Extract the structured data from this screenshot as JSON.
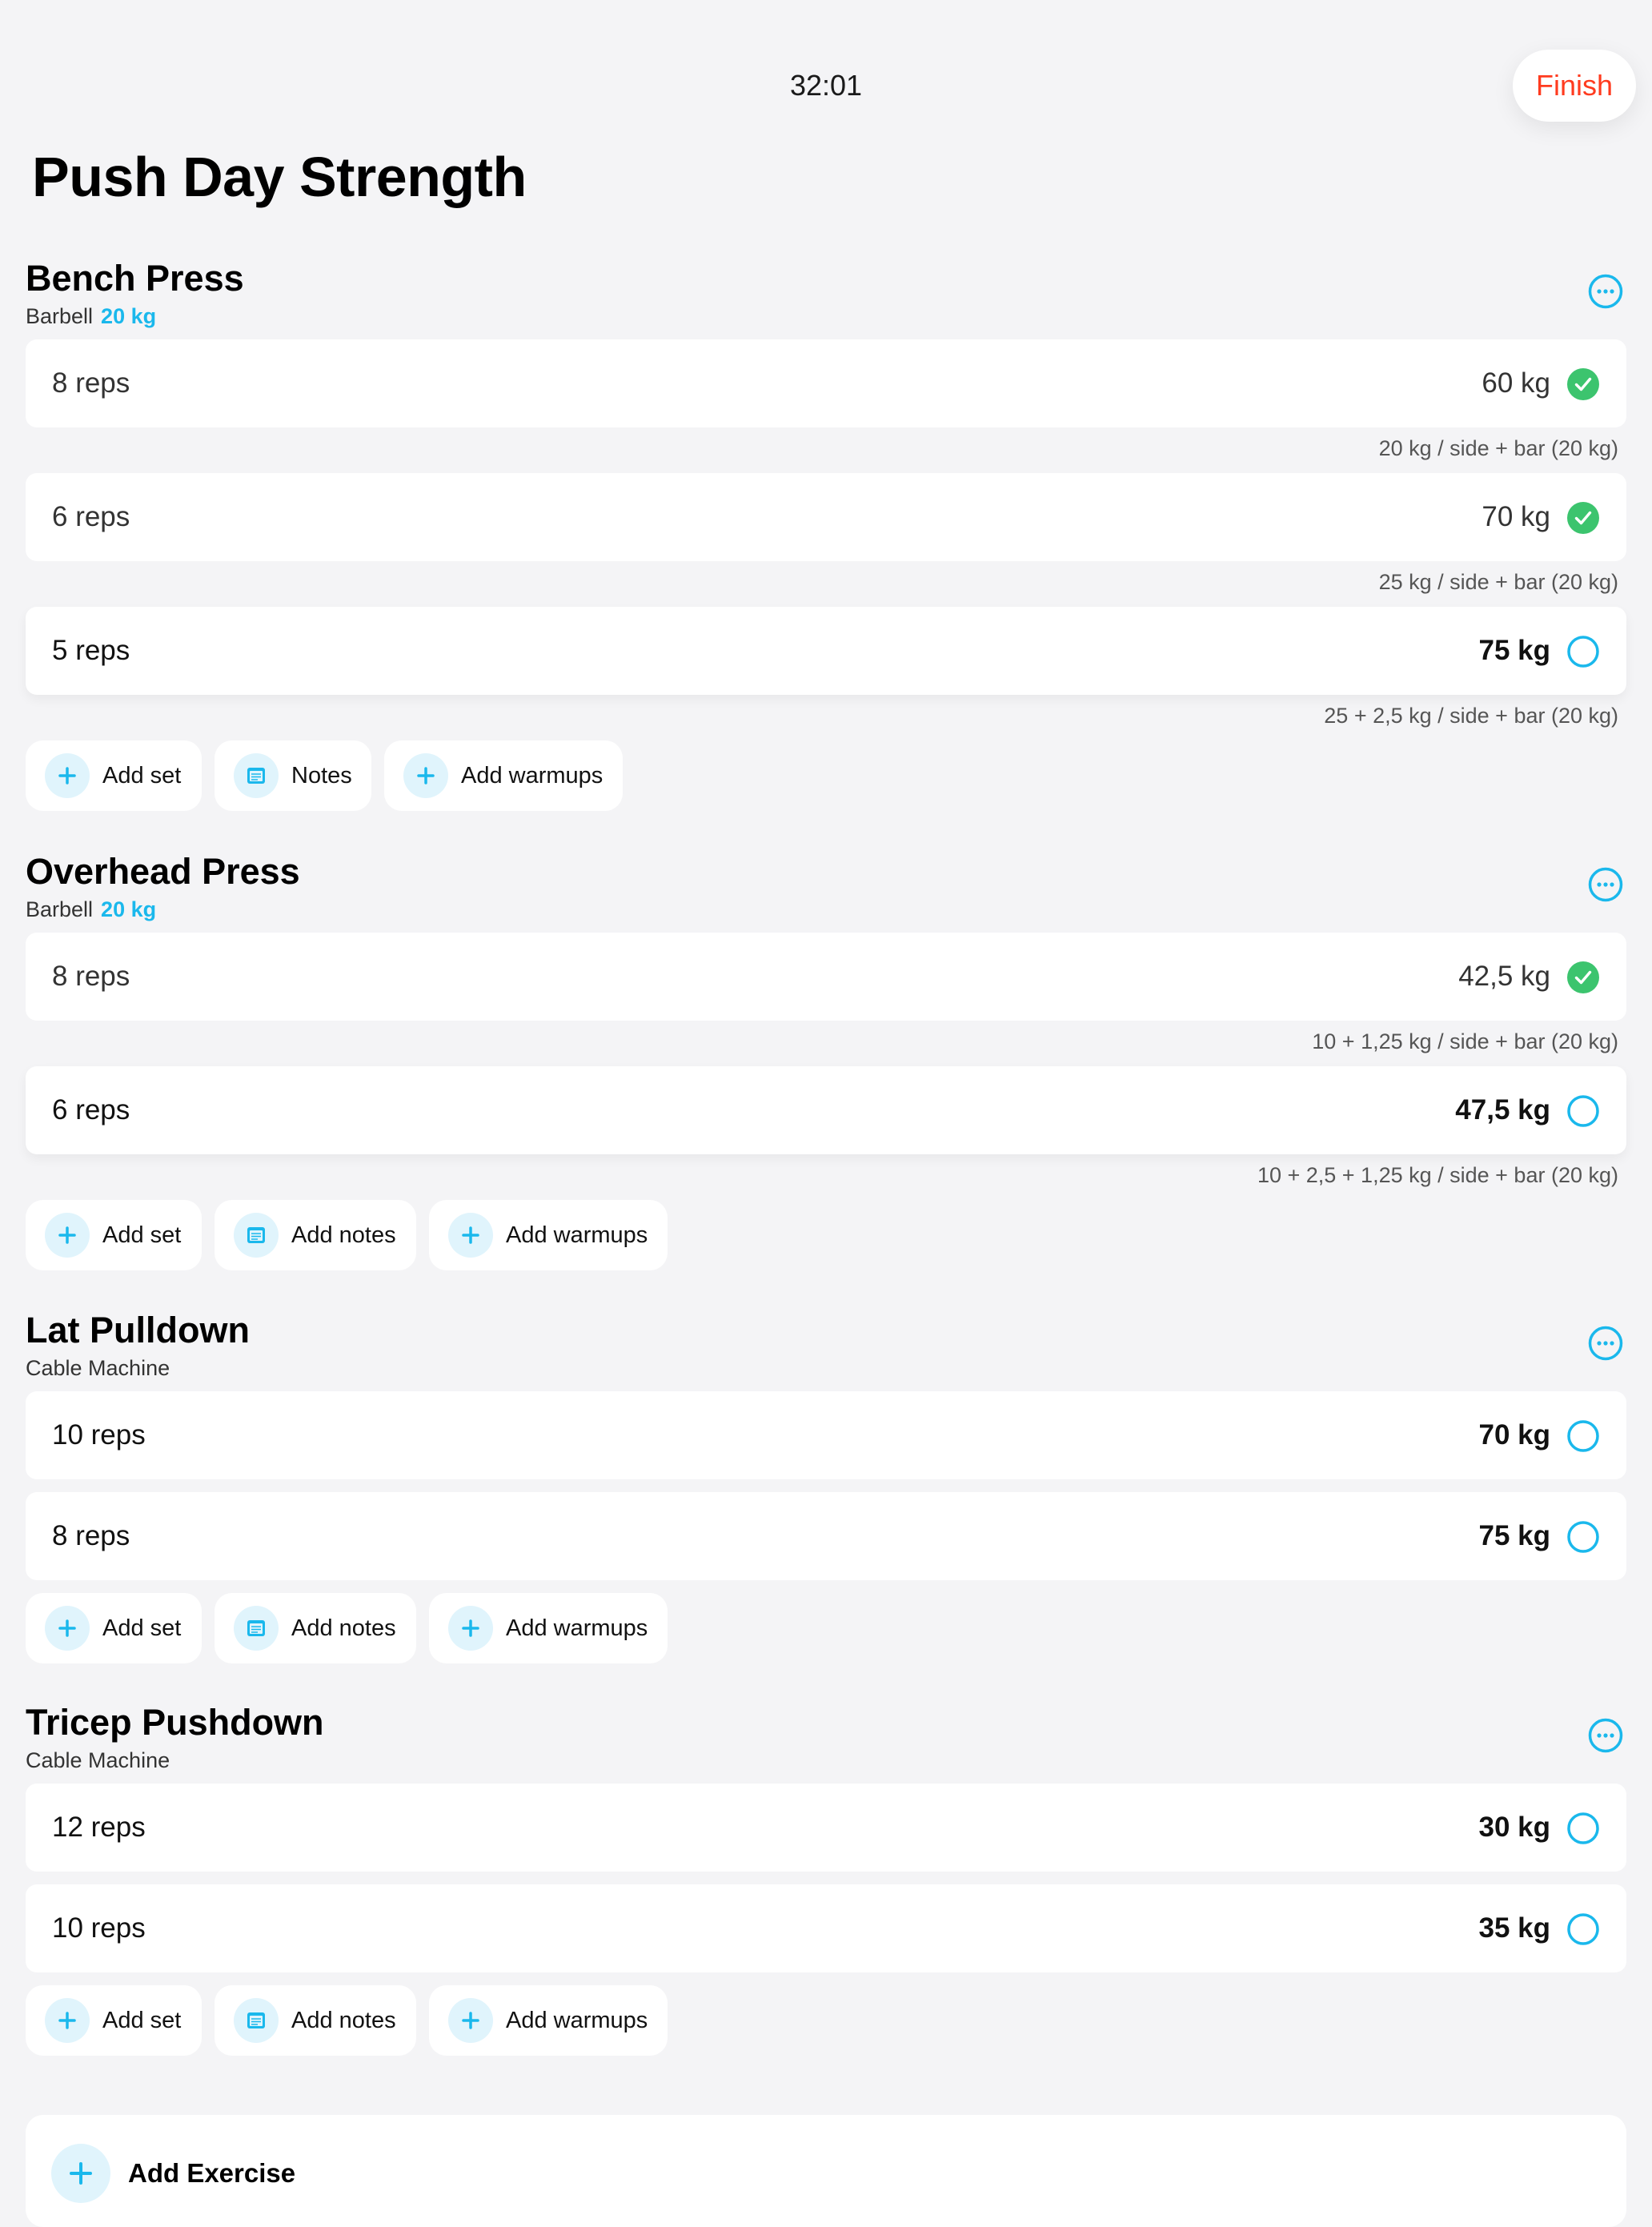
{
  "header": {
    "timer": "32:01",
    "finish_label": "Finish"
  },
  "page_title": "Push Day Strength",
  "colors": {
    "accent": "#1ab8ec",
    "done": "#3cc46e",
    "finish": "#ff3b1f"
  },
  "icons": {
    "more": "more-horizontal-icon",
    "done": "check-circle-icon",
    "pending": "empty-circle-icon",
    "add": "plus-icon",
    "notes": "notes-icon"
  },
  "exercises": [
    {
      "name": "Bench Press",
      "equipment": "Barbell",
      "bar_weight": "20 kg",
      "sets": [
        {
          "reps": "8 reps",
          "weight": "60 kg",
          "done": true,
          "plates": "20 kg / side + bar (20 kg)"
        },
        {
          "reps": "6 reps",
          "weight": "70 kg",
          "done": true,
          "plates": "25 kg / side + bar (20 kg)"
        },
        {
          "reps": "5 reps",
          "weight": "75 kg",
          "done": false,
          "plates": "25 + 2,5 kg / side + bar (20 kg)"
        }
      ],
      "actions": {
        "add_set": "Add set",
        "notes": "Notes",
        "add_warmups": "Add warmups"
      }
    },
    {
      "name": "Overhead Press",
      "equipment": "Barbell",
      "bar_weight": "20 kg",
      "sets": [
        {
          "reps": "8 reps",
          "weight": "42,5 kg",
          "done": true,
          "plates": "10 + 1,25 kg / side + bar (20 kg)"
        },
        {
          "reps": "6 reps",
          "weight": "47,5 kg",
          "done": false,
          "plates": "10 + 2,5 + 1,25 kg / side + bar (20 kg)"
        }
      ],
      "actions": {
        "add_set": "Add set",
        "notes": "Add notes",
        "add_warmups": "Add warmups"
      }
    },
    {
      "name": "Lat Pulldown",
      "equipment": "Cable Machine",
      "sets": [
        {
          "reps": "10 reps",
          "weight": "70 kg",
          "done": false
        },
        {
          "reps": "8 reps",
          "weight": "75 kg",
          "done": false
        }
      ],
      "actions": {
        "add_set": "Add set",
        "notes": "Add notes",
        "add_warmups": "Add warmups"
      }
    },
    {
      "name": "Tricep Pushdown",
      "equipment": "Cable Machine",
      "sets": [
        {
          "reps": "12 reps",
          "weight": "30 kg",
          "done": false
        },
        {
          "reps": "10 reps",
          "weight": "35 kg",
          "done": false
        }
      ],
      "actions": {
        "add_set": "Add set",
        "notes": "Add notes",
        "add_warmups": "Add warmups"
      }
    }
  ],
  "add_exercise_label": "Add Exercise"
}
